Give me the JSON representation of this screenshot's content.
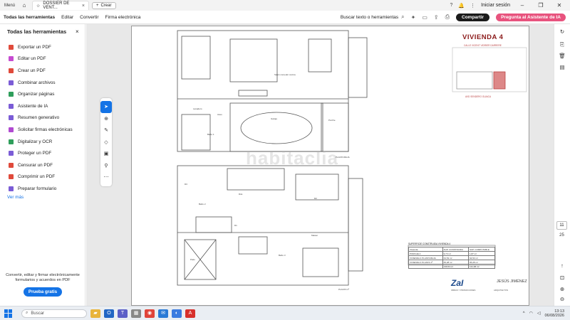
{
  "titlebar": {
    "menu": "Menú",
    "tab_title": "DOSSIER DE VENT...",
    "new_tab": "Crear",
    "sign_in": "Iniciar sesión"
  },
  "toolbar": {
    "tabs": [
      "Todas las herramientas",
      "Editar",
      "Convertir",
      "Firma electrónica"
    ],
    "search": "Buscar texto o herramientas",
    "share": "Compartir",
    "ai_button": "Pregunta al Asistente de IA"
  },
  "sidebar": {
    "title": "Todas las herramientas",
    "items": [
      {
        "label": "Exportar un PDF",
        "color": "#e04a3b"
      },
      {
        "label": "Editar un PDF",
        "color": "#c64bd1"
      },
      {
        "label": "Crear un PDF",
        "color": "#e04a3b"
      },
      {
        "label": "Combinar archivos",
        "color": "#7b5cd6"
      },
      {
        "label": "Organizar páginas",
        "color": "#2f9e5b"
      },
      {
        "label": "Asistente de IA",
        "color": "#7b5cd6"
      },
      {
        "label": "Resumen generativo",
        "color": "#7b5cd6"
      },
      {
        "label": "Solicitar firmas electrónicas",
        "color": "#b04ad1"
      },
      {
        "label": "Digitalizar y OCR",
        "color": "#2f9e5b"
      },
      {
        "label": "Proteger un PDF",
        "color": "#7b5cd6"
      },
      {
        "label": "Censurar un PDF",
        "color": "#e04a3b"
      },
      {
        "label": "Comprimir un PDF",
        "color": "#e04a3b"
      },
      {
        "label": "Preparar formulario",
        "color": "#7b5cd6"
      }
    ],
    "more": "Ver más",
    "footer": "Convertir, editar y firmar electrónicamente formularios y acuerdos en PDF",
    "trial": "Prueba gratis"
  },
  "document": {
    "title": "VIVIENDA 4",
    "subtitle": "CALLE VICENT VIDRIER DARRERE",
    "street": "AVD SENDERO GUAICA",
    "watermark": "habitaclia",
    "ground_label": "PLANTA BAJA",
    "first_label": "PLANTA 1ª",
    "rooms": {
      "salon": "Salón comedor cocina",
      "garaje": "Garaje",
      "porche": "Porche",
      "lavadero": "Lavadero",
      "aseo": "Aseo",
      "banyo1": "Baño 1",
      "dist": "Dist.",
      "d1": "D1",
      "d2": "D2",
      "d3": "D3",
      "master": "Master",
      "banyo2": "Baño 2",
      "banyo3": "Baño 3",
      "patio": "Patio"
    },
    "table": {
      "title": "SUPERFICIE CONSTRUIDA VIVIENDA 4",
      "headers": [
        "Vivienda",
        "SUP. CONSTRUIDA",
        "SUP. COMPUTABLE"
      ],
      "rows": [
        [
          "PORCHE 4",
          "9,73 m²",
          "1,87 m²"
        ],
        [
          "VIVIENDA 4 PLANTA BAJA",
          "64,53 m²",
          "64,53 m²"
        ],
        [
          "VIVIENDA 4 PLANTA 1ª",
          "65,28 m²",
          "65,28 m²"
        ],
        [
          "",
          "139,54 m²",
          "131,68 m²"
        ]
      ]
    },
    "logo_zai": "ZaI",
    "logo_zai_sub": "OBRAS Y PROMOCIONES",
    "logo_jj": "JESÚS JIMÉNEZ",
    "logo_jj_sub": "ARQUITECTOS"
  },
  "page_nav": {
    "current": "11",
    "total": "25"
  },
  "taskbar": {
    "search": "Buscar",
    "time": "13:13",
    "date": "06/08/2026"
  }
}
